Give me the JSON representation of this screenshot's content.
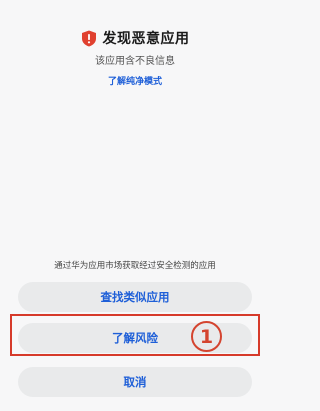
{
  "dialog": {
    "title": "发现恶意应用",
    "subtitle": "该应用含不良信息",
    "pure_mode_link": "了解纯净模式",
    "note": "通过华为应用市场获取经过安全检测的应用",
    "icon": "shield-alert-icon",
    "accent_color": "#1e5fd8",
    "danger_color": "#d63a2a"
  },
  "buttons": {
    "find_similar": "查找类似应用",
    "learn_risk": "了解风险",
    "cancel": "取消"
  },
  "annotation": {
    "marker": "1"
  }
}
